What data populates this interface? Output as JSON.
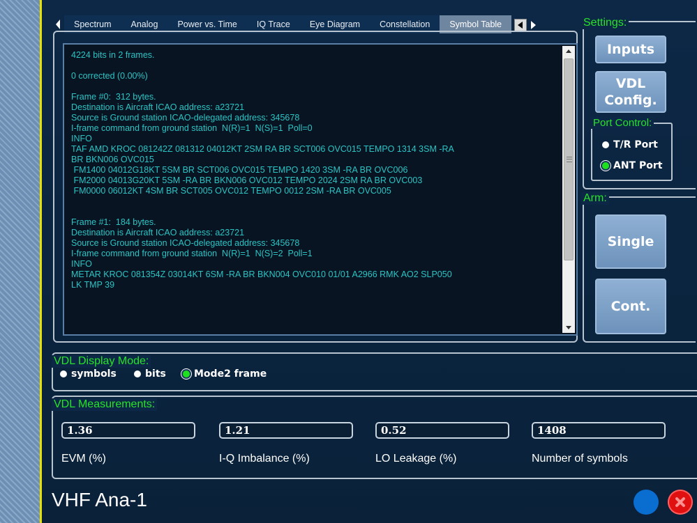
{
  "tabs": {
    "items": [
      {
        "label": "Spectrum"
      },
      {
        "label": "Analog"
      },
      {
        "label": "Power vs. Time"
      },
      {
        "label": "IQ Trace"
      },
      {
        "label": "Eye Diagram"
      },
      {
        "label": "Constellation"
      },
      {
        "label": "Symbol Table"
      }
    ],
    "active": "Symbol Table"
  },
  "symbol_table": {
    "text": "4224 bits in 2 frames.\n\n0 corrected (0.00%)\n\nFrame #0:  312 bytes.\nDestination is Aircraft ICAO address: a23721\nSource is Ground station ICAO-delegated address: 345678\nI-frame command from ground station  N(R)=1  N(S)=1  Poll=0\nINFO\nTAF AMD KROC 081242Z 081312 04012KT 2SM RA BR SCT006 OVC015 TEMPO 1314 3SM -RA\nBR BKN006 OVC015\n FM1400 04012G18KT 5SM BR SCT006 OVC015 TEMPO 1420 3SM -RA BR OVC006\n FM2000 04013G20KT 5SM -RA BR BKN006 OVC012 TEMPO 2024 2SM RA BR OVC003\n FM0000 06012KT 4SM BR SCT005 OVC012 TEMPO 0012 2SM -RA BR OVC005\n\n\nFrame #1:  184 bytes.\nDestination is Aircraft ICAO address: a23721\nSource is Ground station ICAO-delegated address: 345678\nI-frame command from ground station  N(R)=1  N(S)=2  Poll=1\nINFO\nMETAR KROC 081354Z 03014KT 6SM -RA BR BKN004 OVC010 01/01 A2966 RMK AO2 SLP050\nLK TMP 39"
  },
  "settings": {
    "title": "Settings:",
    "inputs_label": "Inputs",
    "vdl_config_label": "VDL\nConfig.",
    "port_control": {
      "title": "Port Control:",
      "options": [
        {
          "label": "T/R Port",
          "selected": false
        },
        {
          "label": "ANT Port",
          "selected": true
        }
      ]
    }
  },
  "arm": {
    "title": "Arm:",
    "single_label": "Single",
    "cont_label": "Cont."
  },
  "display_mode": {
    "title": "VDL Display Mode:",
    "options": [
      {
        "label": "symbols",
        "selected": false
      },
      {
        "label": "bits",
        "selected": false
      },
      {
        "label": "Mode2 frame",
        "selected": true
      }
    ]
  },
  "measurements": {
    "title": "VDL Measurements:",
    "items": [
      {
        "value": "1.36",
        "label": "EVM (%)"
      },
      {
        "value": "1.21",
        "label": "I-Q Imbalance (%)"
      },
      {
        "value": "0.52",
        "label": "LO Leakage (%)"
      },
      {
        "value": "1408",
        "label": "Number of symbols"
      }
    ]
  },
  "app": {
    "title": "VHF Ana-1"
  },
  "colors": {
    "accent_green": "#27e327",
    "text_cyan": "#2bc4c4",
    "button_blue": "#7a9cc4",
    "close_red": "#e01010",
    "highlight_yellow": "#e8e000"
  }
}
